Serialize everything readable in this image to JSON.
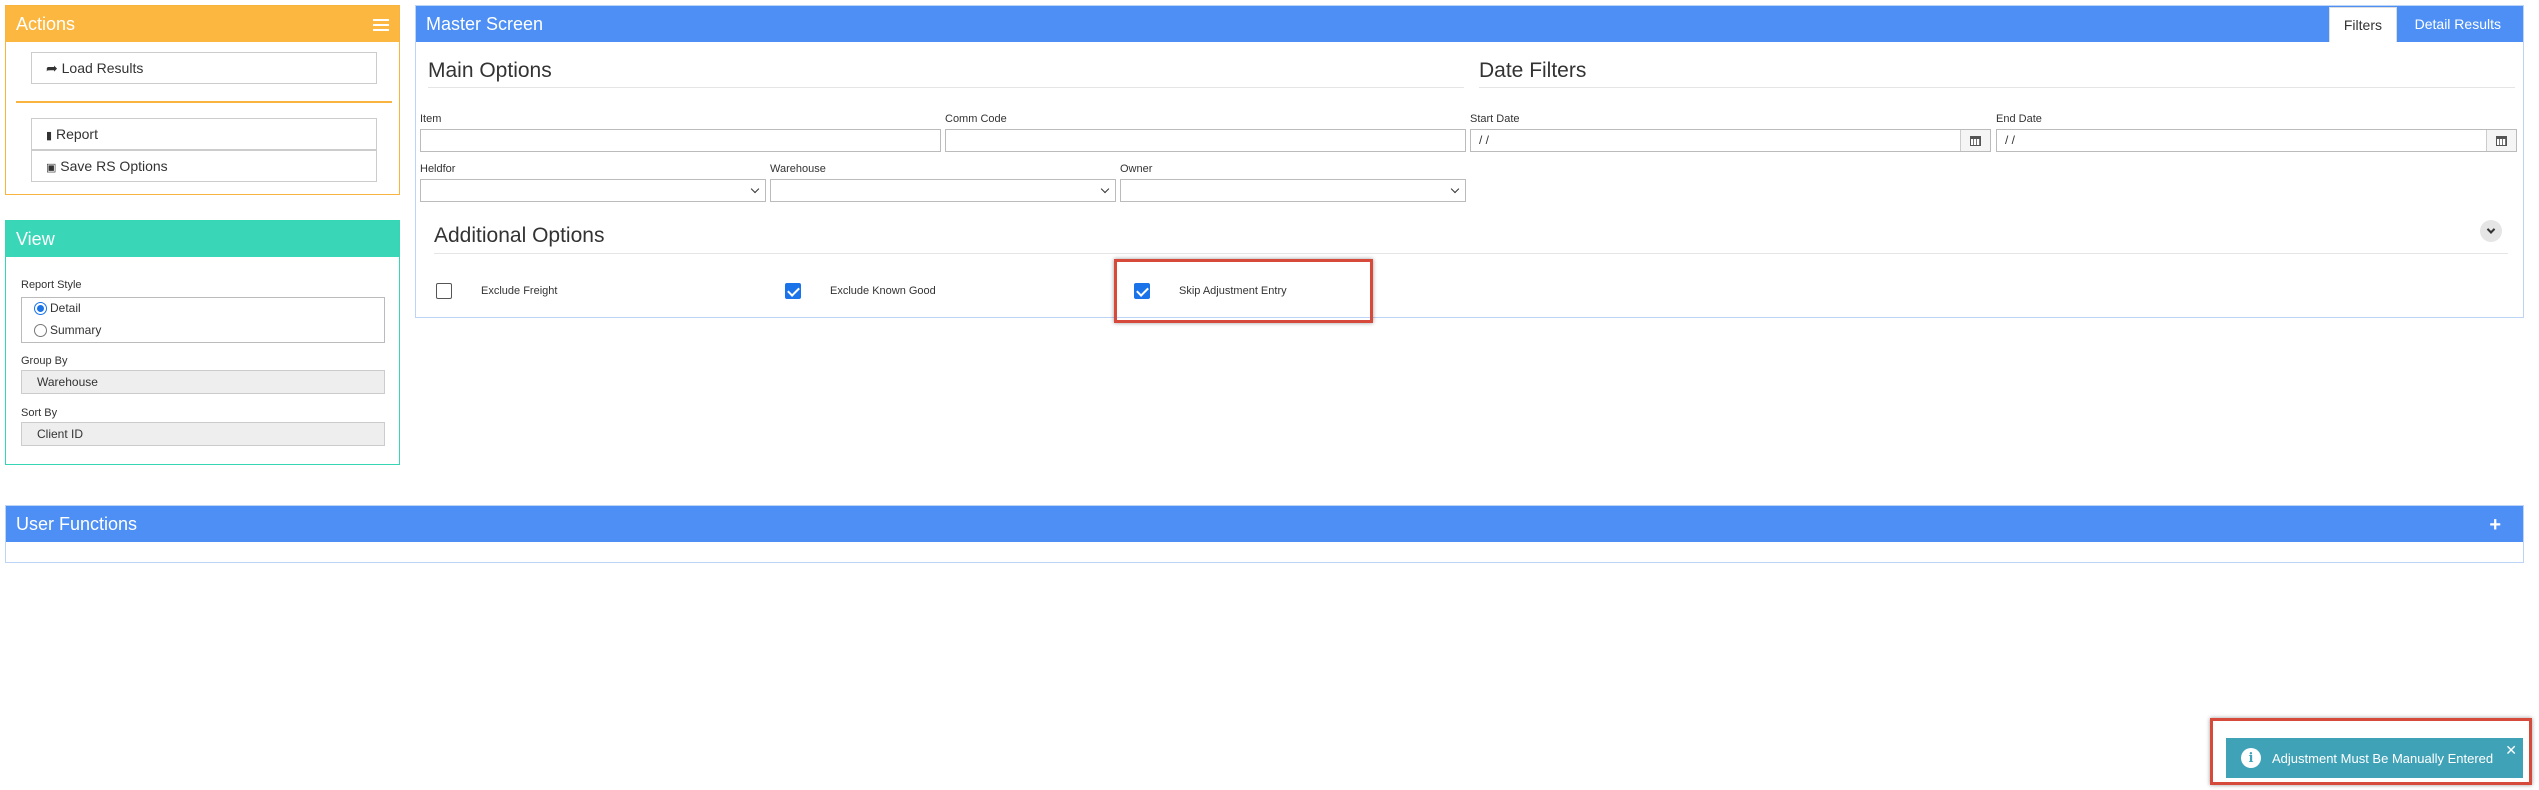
{
  "actions": {
    "title": "Actions",
    "load_results": "Load Results",
    "report": "Report",
    "save_rs_options": "Save RS Options"
  },
  "view": {
    "title": "View",
    "report_style_label": "Report Style",
    "report_style_options": [
      "Detail",
      "Summary"
    ],
    "report_style_selected": "Detail",
    "group_by_label": "Group By",
    "group_by_value": "Warehouse",
    "sort_by_label": "Sort By",
    "sort_by_value": "Client ID"
  },
  "master": {
    "title": "Master Screen",
    "tabs": [
      {
        "label": "Filters",
        "active": true
      },
      {
        "label": "Detail Results",
        "active": false
      }
    ],
    "main_options_title": "Main Options",
    "date_filters_title": "Date Filters",
    "item_label": "Item",
    "item_value": "",
    "comm_code_label": "Comm Code",
    "comm_code_value": "",
    "start_date_label": "Start Date",
    "start_date_value": " /  /",
    "end_date_label": "End Date",
    "end_date_value": " /  /",
    "heldfor_label": "Heldfor",
    "warehouse_label": "Warehouse",
    "owner_label": "Owner",
    "additional_options_title": "Additional Options",
    "checkboxes": [
      {
        "label": "Exclude Freight",
        "checked": false
      },
      {
        "label": "Exclude Known Good",
        "checked": true
      },
      {
        "label": "Skip Adjustment Entry",
        "checked": true
      }
    ]
  },
  "user_functions": {
    "title": "User Functions"
  },
  "toast": {
    "message": "Adjustment Must Be Manually Entered",
    "color": "#3fa2b7"
  },
  "colors": {
    "actions_accent": "#fcb740",
    "view_accent": "#39d6b8",
    "primary": "#4d8ff5",
    "highlight": "#d64a3b"
  }
}
